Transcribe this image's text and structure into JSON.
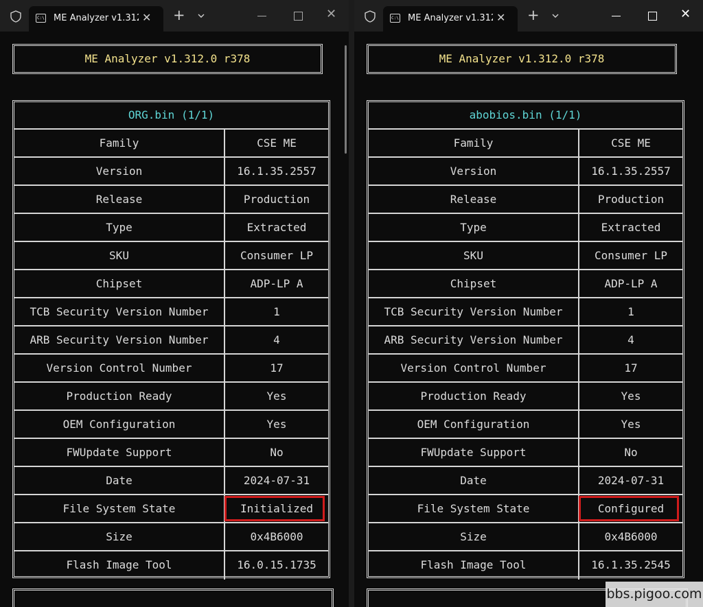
{
  "left": {
    "tab_title": "ME Analyzer v1.312.",
    "app_title": "ME Analyzer v1.312.0 r378",
    "table_header": "ORG.bin (1/1)",
    "rows": [
      {
        "label": "Family",
        "value": "CSE ME"
      },
      {
        "label": "Version",
        "value": "16.1.35.2557"
      },
      {
        "label": "Release",
        "value": "Production"
      },
      {
        "label": "Type",
        "value": "Extracted"
      },
      {
        "label": "SKU",
        "value": "Consumer LP"
      },
      {
        "label": "Chipset",
        "value": "ADP-LP A"
      },
      {
        "label": "TCB Security Version Number",
        "value": "1"
      },
      {
        "label": "ARB Security Version Number",
        "value": "4"
      },
      {
        "label": "Version Control Number",
        "value": "17"
      },
      {
        "label": "Production Ready",
        "value": "Yes"
      },
      {
        "label": "OEM Configuration",
        "value": "Yes"
      },
      {
        "label": "FWUpdate Support",
        "value": "No"
      },
      {
        "label": "Date",
        "value": "2024-07-31"
      },
      {
        "label": "File System State",
        "value": "Initialized"
      },
      {
        "label": "Size",
        "value": "0x4B6000"
      },
      {
        "label": "Flash Image Tool",
        "value": "16.0.15.1735"
      }
    ]
  },
  "right": {
    "tab_title": "ME Analyzer v1.312.",
    "app_title": "ME Analyzer v1.312.0 r378",
    "table_header": "abobios.bin (1/1)",
    "rows": [
      {
        "label": "Family",
        "value": "CSE ME"
      },
      {
        "label": "Version",
        "value": "16.1.35.2557"
      },
      {
        "label": "Release",
        "value": "Production"
      },
      {
        "label": "Type",
        "value": "Extracted"
      },
      {
        "label": "SKU",
        "value": "Consumer LP"
      },
      {
        "label": "Chipset",
        "value": "ADP-LP A"
      },
      {
        "label": "TCB Security Version Number",
        "value": "1"
      },
      {
        "label": "ARB Security Version Number",
        "value": "4"
      },
      {
        "label": "Version Control Number",
        "value": "17"
      },
      {
        "label": "Production Ready",
        "value": "Yes"
      },
      {
        "label": "OEM Configuration",
        "value": "Yes"
      },
      {
        "label": "FWUpdate Support",
        "value": "No"
      },
      {
        "label": "Date",
        "value": "2024-07-31"
      },
      {
        "label": "File System State",
        "value": "Configured"
      },
      {
        "label": "Size",
        "value": "0x4B6000"
      },
      {
        "label": "Flash Image Tool",
        "value": "16.1.35.2545"
      }
    ]
  },
  "colors": {
    "title_text": "#f3e28c",
    "header_text": "#5fd6d6",
    "highlight": "#d01c1c"
  },
  "icons": {
    "shield": "shield-icon",
    "terminal": "terminal-icon",
    "add": "plus-icon",
    "dropdown": "chevron-down-icon",
    "close": "close-icon"
  },
  "watermark": "bbs.pigoo.com"
}
